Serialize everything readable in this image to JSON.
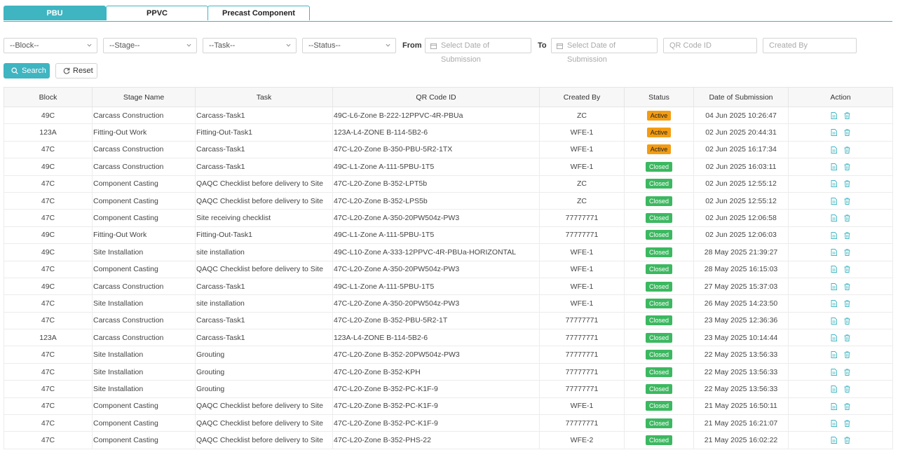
{
  "tabs": [
    {
      "label": "PBU",
      "active": true
    },
    {
      "label": "PPVC",
      "active": false
    },
    {
      "label": "Precast Component",
      "active": false
    }
  ],
  "filters": {
    "block": "--Block--",
    "stage": "--Stage--",
    "task": "--Task--",
    "status": "--Status--",
    "from_label": "From",
    "to_label": "To",
    "from_placeholder": "Select Date of Submission",
    "to_placeholder": "Select Date of Submission",
    "qr_placeholder": "QR Code ID",
    "created_by_placeholder": "Created By"
  },
  "buttons": {
    "search": "Search",
    "reset": "Reset"
  },
  "colors": {
    "accent": "#3fb5c1",
    "active": "#f39c12",
    "closed": "#3cb860"
  },
  "table": {
    "headers": [
      "Block",
      "Stage Name",
      "Task",
      "QR Code ID",
      "Created By",
      "Status",
      "Date of Submission",
      "Action"
    ],
    "rows": [
      [
        "49C",
        "Carcass Construction",
        "Carcass-Task1",
        "49C-L6-Zone B-222-12PPVC-4R-PBUa",
        "ZC",
        "Active",
        "04 Jun 2025 10:26:47"
      ],
      [
        "123A",
        "Fitting-Out Work",
        "Fitting-Out-Task1",
        "123A-L4-ZONE B-114-5B2-6",
        "WFE-1",
        "Active",
        "02 Jun 2025 20:44:31"
      ],
      [
        "47C",
        "Carcass Construction",
        "Carcass-Task1",
        "47C-L20-Zone B-350-PBU-5R2-1TX",
        "WFE-1",
        "Active",
        "02 Jun 2025 16:17:34"
      ],
      [
        "49C",
        "Carcass Construction",
        "Carcass-Task1",
        "49C-L1-Zone A-111-5PBU-1T5",
        "WFE-1",
        "Closed",
        "02 Jun 2025 16:03:11"
      ],
      [
        "47C",
        "Component Casting",
        "QAQC Checklist before delivery to Site",
        "47C-L20-Zone B-352-LPT5b",
        "ZC",
        "Closed",
        "02 Jun 2025 12:55:12"
      ],
      [
        "47C",
        "Component Casting",
        "QAQC Checklist before delivery to Site",
        "47C-L20-Zone B-352-LPS5b",
        "ZC",
        "Closed",
        "02 Jun 2025 12:55:12"
      ],
      [
        "47C",
        "Component Casting",
        "Site receiving checklist",
        "47C-L20-Zone A-350-20PW504z-PW3",
        "77777771",
        "Closed",
        "02 Jun 2025 12:06:58"
      ],
      [
        "49C",
        "Fitting-Out Work",
        "Fitting-Out-Task1",
        "49C-L1-Zone A-111-5PBU-1T5",
        "77777771",
        "Closed",
        "02 Jun 2025 12:06:03"
      ],
      [
        "49C",
        "Site Installation",
        "site installation",
        "49C-L10-Zone A-333-12PPVC-4R-PBUa-HORIZONTAL",
        "WFE-1",
        "Closed",
        "28 May 2025 21:39:27"
      ],
      [
        "47C",
        "Component Casting",
        "QAQC Checklist before delivery to Site",
        "47C-L20-Zone A-350-20PW504z-PW3",
        "WFE-1",
        "Closed",
        "28 May 2025 16:15:03"
      ],
      [
        "49C",
        "Carcass Construction",
        "Carcass-Task1",
        "49C-L1-Zone A-111-5PBU-1T5",
        "WFE-1",
        "Closed",
        "27 May 2025 15:37:03"
      ],
      [
        "47C",
        "Site Installation",
        "site installation",
        "47C-L20-Zone A-350-20PW504z-PW3",
        "WFE-1",
        "Closed",
        "26 May 2025 14:23:50"
      ],
      [
        "47C",
        "Carcass Construction",
        "Carcass-Task1",
        "47C-L20-Zone B-352-PBU-5R2-1T",
        "77777771",
        "Closed",
        "23 May 2025 12:36:36"
      ],
      [
        "123A",
        "Carcass Construction",
        "Carcass-Task1",
        "123A-L4-ZONE B-114-5B2-6",
        "77777771",
        "Closed",
        "23 May 2025 10:14:44"
      ],
      [
        "47C",
        "Site Installation",
        "Grouting",
        "47C-L20-Zone B-352-20PW504z-PW3",
        "77777771",
        "Closed",
        "22 May 2025 13:56:33"
      ],
      [
        "47C",
        "Site Installation",
        "Grouting",
        "47C-L20-Zone B-352-KPH",
        "77777771",
        "Closed",
        "22 May 2025 13:56:33"
      ],
      [
        "47C",
        "Site Installation",
        "Grouting",
        "47C-L20-Zone B-352-PC-K1F-9",
        "77777771",
        "Closed",
        "22 May 2025 13:56:33"
      ],
      [
        "47C",
        "Component Casting",
        "QAQC Checklist before delivery to Site",
        "47C-L20-Zone B-352-PC-K1F-9",
        "WFE-1",
        "Closed",
        "21 May 2025 16:50:11"
      ],
      [
        "47C",
        "Component Casting",
        "QAQC Checklist before delivery to Site",
        "47C-L20-Zone B-352-PC-K1F-9",
        "77777771",
        "Closed",
        "21 May 2025 16:21:07"
      ],
      [
        "47C",
        "Component Casting",
        "QAQC Checklist before delivery to Site",
        "47C-L20-Zone B-352-PHS-22",
        "WFE-2",
        "Closed",
        "21 May 2025 16:02:22"
      ]
    ]
  }
}
